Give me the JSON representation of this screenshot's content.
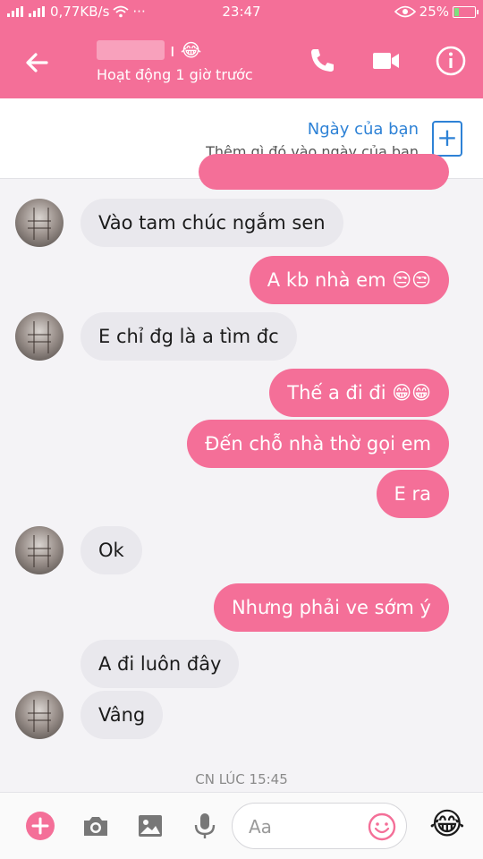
{
  "status_bar": {
    "network_speed": "0,77KB/s",
    "dots": "···",
    "time": "23:47",
    "battery": "25%",
    "battery_level": 0.25
  },
  "header": {
    "name_suffix": "ı 😂",
    "status": "Hoạt động 1 giờ trước",
    "icons": [
      "back-arrow-icon",
      "phone-icon",
      "video-camera-icon",
      "info-icon"
    ]
  },
  "your_day": {
    "title": "Ngày của bạn",
    "subtitle": "Thêm gì đó vào ngày của bạn",
    "add_symbol": "+"
  },
  "messages": [
    {
      "side": "in",
      "text": "Vào tam chúc ngắm sen"
    },
    {
      "side": "out",
      "text": "A kb nhà em 😒😒"
    },
    {
      "side": "in",
      "text": "E chỉ đg là a tìm đc"
    },
    {
      "side": "out",
      "text": "Thế a đi đi 😁😁"
    },
    {
      "side": "out",
      "text": "Đến chỗ nhà thờ gọi em"
    },
    {
      "side": "out",
      "text": "E ra"
    },
    {
      "side": "in",
      "text": "Ok"
    },
    {
      "side": "out",
      "text": "Nhưng phải ve sớm ý"
    },
    {
      "side": "in",
      "text": "A đi luôn đây"
    },
    {
      "side": "in",
      "text": "Vâng"
    }
  ],
  "timestamp": "CN LÚC 15:45",
  "composer": {
    "placeholder": "Aa",
    "send_emoji": "😂",
    "icons": [
      "plus-icon",
      "camera-icon",
      "image-icon",
      "microphone-icon",
      "smiley-icon"
    ]
  }
}
